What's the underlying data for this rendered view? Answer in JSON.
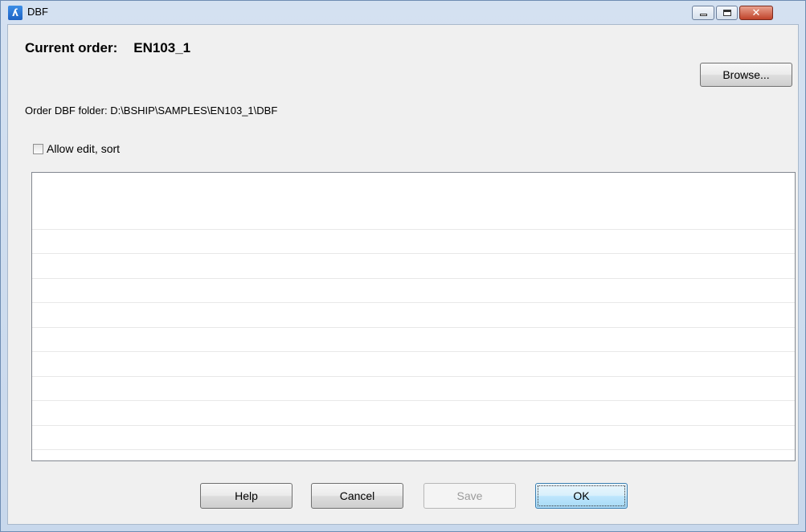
{
  "window": {
    "title": "DBF",
    "app_icon": "bricscad-icon",
    "controls": {
      "minimize": "minimize-icon",
      "maximize": "maximize-icon",
      "close": "close-icon",
      "close_glyph": "✕"
    }
  },
  "header": {
    "current_order_label": "Current order:",
    "current_order_value": "EN103_1",
    "browse_label": "Browse..."
  },
  "folder_text": "Order DBF folder: D:\\BSHIP\\SAMPLES\\EN103_1\\DBF",
  "allow_edit": {
    "label": "Allow edit, sort",
    "checked": false
  },
  "grid": {
    "rows": []
  },
  "buttons": {
    "help": "Help",
    "cancel": "Cancel",
    "save": "Save",
    "ok": "OK"
  },
  "colors": {
    "accent": "#3c7fb1",
    "close": "#c0432a"
  }
}
